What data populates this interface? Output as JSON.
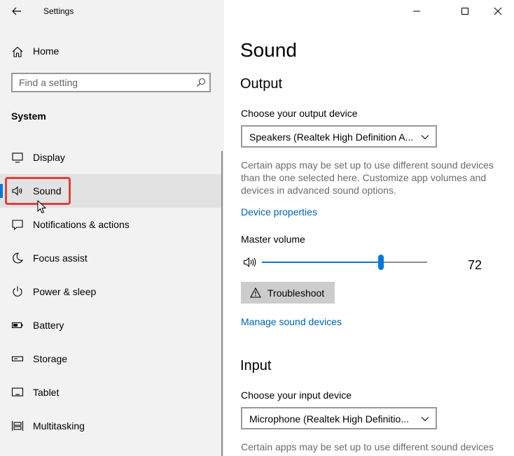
{
  "app": {
    "title": "Settings"
  },
  "sidebar": {
    "home_label": "Home",
    "search_placeholder": "Find a setting",
    "section_title": "System",
    "selected_index": 1,
    "items": [
      {
        "label": "Display",
        "icon": "display-icon"
      },
      {
        "label": "Sound",
        "icon": "speaker-icon"
      },
      {
        "label": "Notifications & actions",
        "icon": "notifications-icon"
      },
      {
        "label": "Focus assist",
        "icon": "moon-icon"
      },
      {
        "label": "Power & sleep",
        "icon": "power-icon"
      },
      {
        "label": "Battery",
        "icon": "battery-icon"
      },
      {
        "label": "Storage",
        "icon": "storage-icon"
      },
      {
        "label": "Tablet",
        "icon": "tablet-icon"
      },
      {
        "label": "Multitasking",
        "icon": "multitasking-icon"
      }
    ]
  },
  "main": {
    "page_title": "Sound",
    "output": {
      "heading": "Output",
      "device_label": "Choose your output device",
      "device_value": "Speakers (Realtek High Definition A...",
      "description": "Certain apps may be set up to use different sound devices than the one selected here. Customize app volumes and devices in advanced sound options.",
      "device_properties_link": "Device properties",
      "master_volume_label": "Master volume",
      "volume": 72,
      "troubleshoot_label": "Troubleshoot",
      "manage_link": "Manage sound devices"
    },
    "input": {
      "heading": "Input",
      "device_label": "Choose your input device",
      "device_value": "Microphone (Realtek High Definitio...",
      "description": "Certain apps may be set up to use different sound devices"
    }
  },
  "colors": {
    "accent": "#0078d7",
    "link": "#0063b1",
    "highlight": "#e04040",
    "sidebar_bg": "#f2f2f2",
    "selected_bg": "#e2e2e2"
  }
}
